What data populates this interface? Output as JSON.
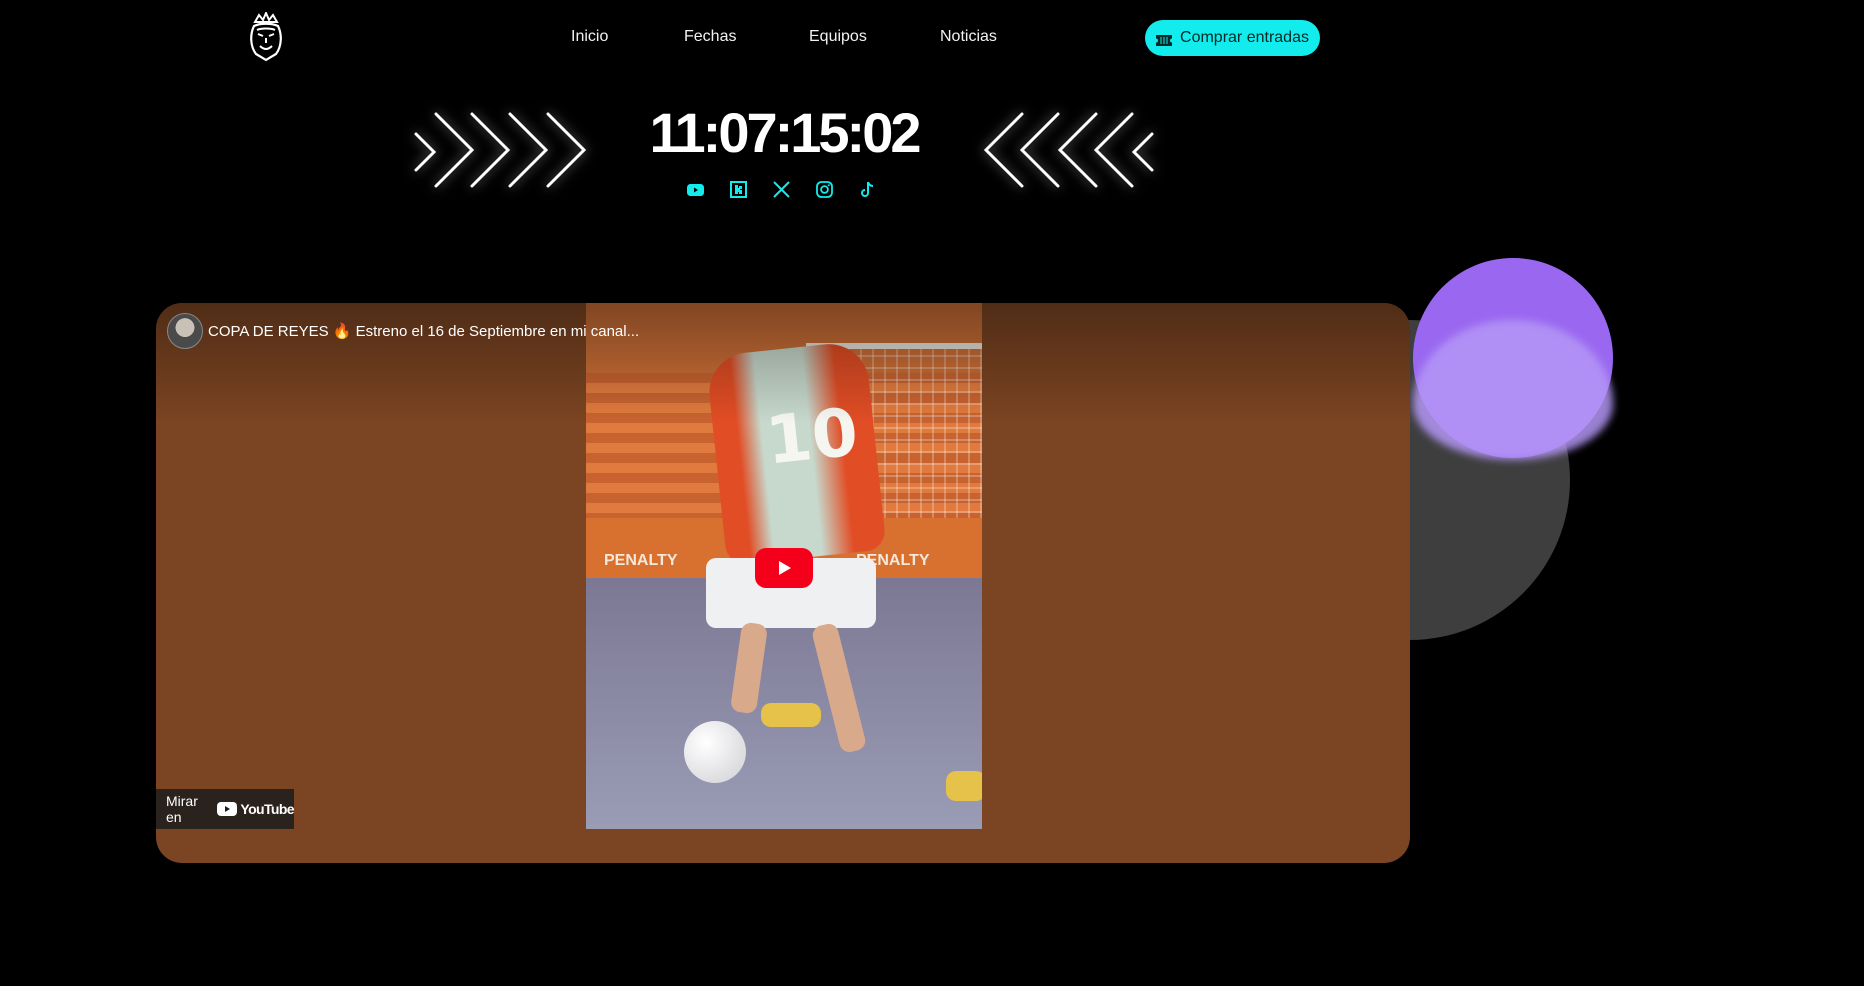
{
  "header": {
    "logo_icon": "lion-crown-logo",
    "nav": [
      {
        "label": "Inicio"
      },
      {
        "label": "Fechas"
      },
      {
        "label": "Equipos"
      },
      {
        "label": "Noticias"
      }
    ],
    "cta": {
      "label": "Comprar entradas",
      "icon": "ticket-icon",
      "color": "#12ecec"
    }
  },
  "hero": {
    "countdown": "11:07:15:02",
    "socials": [
      "youtube-icon",
      "kick-icon",
      "x-icon",
      "instagram-icon",
      "tiktok-icon"
    ],
    "social_color": "#12ecec"
  },
  "video": {
    "title": "COPA DE REYES",
    "title_emoji": "🔥",
    "title_rest": " Estreno el 16 de Septiembre en mi canal...",
    "watch_on_label": "Mirar en",
    "youtube_label": "YouTube",
    "frame": {
      "jersey_number": "10",
      "ad_text": "PENALTY"
    }
  },
  "colors": {
    "background": "#000000",
    "accent": "#12ecec",
    "purple": "#9a68f0",
    "video_bg": "#7b4422",
    "play_red": "#f4001b"
  }
}
